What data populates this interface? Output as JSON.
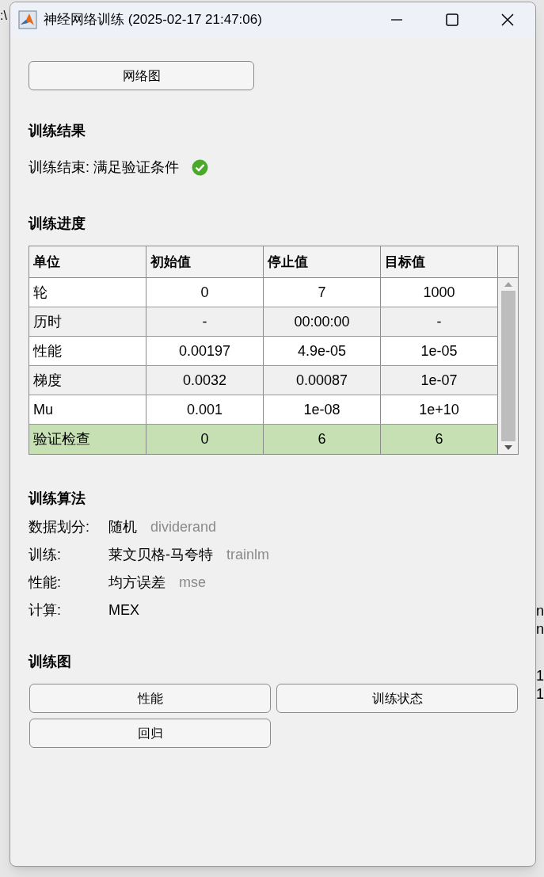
{
  "window": {
    "title": "神经网络训练 (2025-02-17 21:47:06)"
  },
  "backdrop": {
    "left_fragment": ":\\",
    "right_fragments": [
      "n",
      "n",
      "1",
      "1"
    ]
  },
  "network_button": "网络图",
  "results": {
    "heading": "训练结果",
    "message": "训练结束: 满足验证条件",
    "success": true
  },
  "progress": {
    "heading": "训练进度",
    "columns": [
      "单位",
      "初始值",
      "停止值",
      "目标值"
    ],
    "rows": [
      {
        "cells": [
          "轮",
          "0",
          "7",
          "1000"
        ],
        "highlighted": false
      },
      {
        "cells": [
          "历时",
          "-",
          "00:00:00",
          "-"
        ],
        "highlighted": false
      },
      {
        "cells": [
          "性能",
          "0.00197",
          "4.9e-05",
          "1e-05"
        ],
        "highlighted": false
      },
      {
        "cells": [
          "梯度",
          "0.0032",
          "0.00087",
          "1e-07"
        ],
        "highlighted": false
      },
      {
        "cells": [
          "Mu",
          "0.001",
          "1e-08",
          "1e+10"
        ],
        "highlighted": false
      },
      {
        "cells": [
          "验证检查",
          "0",
          "6",
          "6"
        ],
        "highlighted": true
      }
    ]
  },
  "algorithms": {
    "heading": "训练算法",
    "items": [
      {
        "label": "数据划分:",
        "value": "随机",
        "function": "dividerand"
      },
      {
        "label": "训练:",
        "value": "莱文贝格-马夸特",
        "function": "trainlm"
      },
      {
        "label": "性能:",
        "value": "均方误差",
        "function": "mse"
      },
      {
        "label": "计算:",
        "value": "MEX"
      }
    ]
  },
  "plots": {
    "heading": "训练图",
    "buttons": [
      "性能",
      "训练状态",
      "回归"
    ]
  }
}
